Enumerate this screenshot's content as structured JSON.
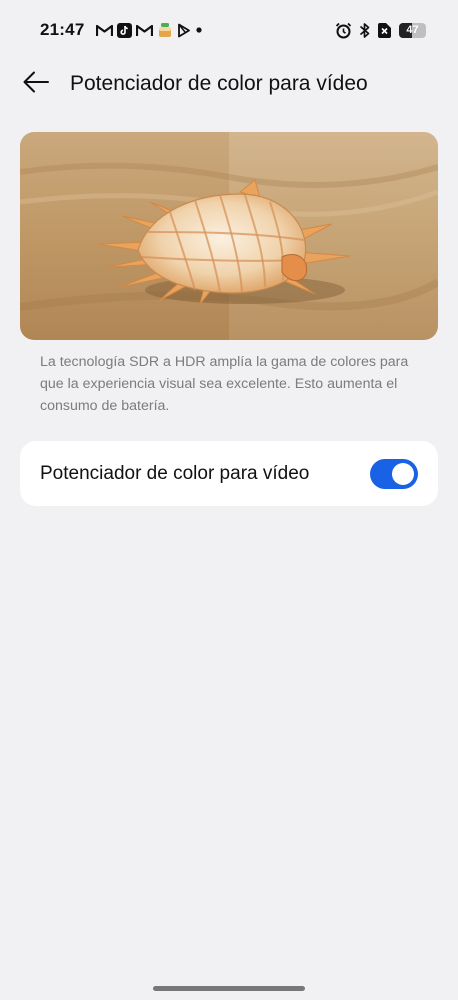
{
  "status_bar": {
    "time": "21:47",
    "notification_icons": [
      "gmail-icon",
      "tiktok-icon",
      "gmail-icon",
      "cake-app-icon",
      "play-store-icon",
      "more-dot-icon"
    ],
    "system_icons": [
      "alarm-icon",
      "bluetooth-icon",
      "no-sim-icon"
    ],
    "battery_level": "47",
    "battery_fraction": 0.47
  },
  "header": {
    "back_icon": "arrow-left-icon",
    "title": "Potenciador de color para vídeo"
  },
  "preview": {
    "image": "seashell-on-sand-comparison"
  },
  "description": "La tecnología SDR a HDR amplía la gama de colores para que la experiencia visual sea excelente. Esto aumenta el consumo de batería.",
  "setting": {
    "label": "Potenciador de color para vídeo",
    "enabled": true,
    "accent_color": "#1a62e5"
  }
}
